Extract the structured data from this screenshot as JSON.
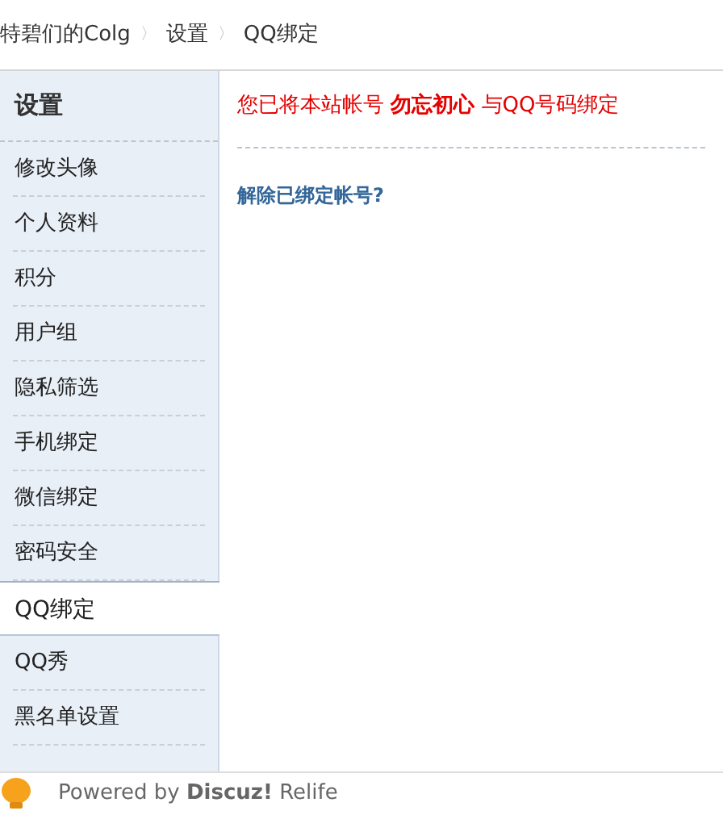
{
  "breadcrumb": [
    "特碧们的Colg",
    "设置",
    "QQ绑定"
  ],
  "breadcrumb_separator": "〉",
  "sidebar": {
    "title": "设置",
    "items": [
      {
        "label": "修改头像",
        "selected": false
      },
      {
        "label": "个人资料",
        "selected": false
      },
      {
        "label": "积分",
        "selected": false
      },
      {
        "label": "用户组",
        "selected": false
      },
      {
        "label": "隐私筛选",
        "selected": false
      },
      {
        "label": "手机绑定",
        "selected": false
      },
      {
        "label": "微信绑定",
        "selected": false
      },
      {
        "label": "密码安全",
        "selected": false
      },
      {
        "label": "QQ绑定",
        "selected": true
      },
      {
        "label": "QQ秀",
        "selected": false
      },
      {
        "label": "黑名单设置",
        "selected": false
      }
    ]
  },
  "message": "您已将本站帐号 **勿忘初心** 与QQ号码绑定",
  "unbind_link": "解除已绑定帐号?",
  "footer": "Powered by **Discuz!** Relife"
}
